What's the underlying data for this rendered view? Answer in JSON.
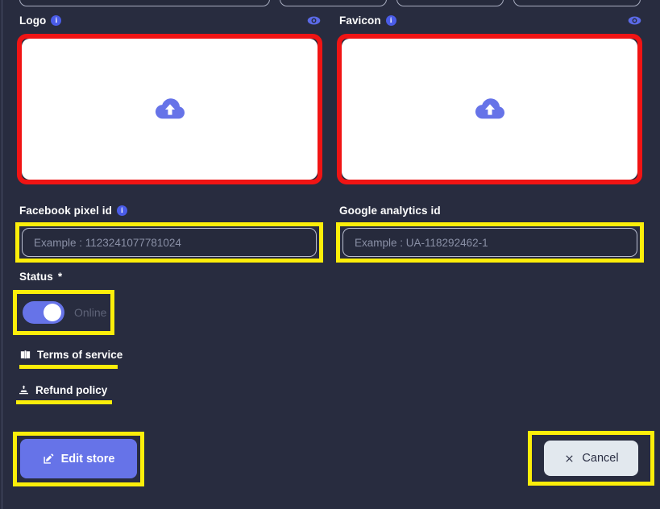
{
  "theme": {
    "background": "#282c3f",
    "accent": "#6673e8",
    "info_icon": "#4a5ce8",
    "annotation_red": "#f01414",
    "annotation_yellow": "#fcee0a",
    "input_background": "#262a3c",
    "placeholder_text": "#8a90a6",
    "cancel_button_bg": "#e2e8ee"
  },
  "top_partial_fields": {
    "note": "four rounded input outlines cut off at the top edge",
    "count": 4
  },
  "logo": {
    "label": "Logo",
    "info_icon": "info-circle-icon",
    "preview_icon": "eye-icon",
    "upload_icon": "cloud-upload-icon",
    "annotation": "red"
  },
  "favicon": {
    "label": "Favicon",
    "info_icon": "info-circle-icon",
    "preview_icon": "eye-icon",
    "upload_icon": "cloud-upload-icon",
    "annotation": "red"
  },
  "facebook_pixel": {
    "label": "Facebook pixel id",
    "info_icon": "info-circle-icon",
    "placeholder": "Example : 1123241077781024",
    "value": "",
    "annotation": "yellow"
  },
  "google_analytics": {
    "label": "Google analytics id",
    "placeholder": "Example : UA-118292462-1",
    "value": "",
    "annotation": "yellow"
  },
  "status": {
    "label": "Status",
    "required_mark": "*",
    "toggle_state": "on",
    "toggle_label": "Online",
    "annotation": "yellow"
  },
  "documents": [
    {
      "label": "Terms of service",
      "icon": "book-open-icon",
      "highlight": "yellow"
    },
    {
      "label": "Refund policy",
      "icon": "hand-receiving-icon",
      "highlight": "yellow"
    }
  ],
  "actions": {
    "edit_store": {
      "label": "Edit store",
      "icon": "edit-pencil-square-icon",
      "annotation": "yellow"
    },
    "cancel": {
      "label": "Cancel",
      "icon": "close-x-icon",
      "annotation": "yellow"
    }
  }
}
